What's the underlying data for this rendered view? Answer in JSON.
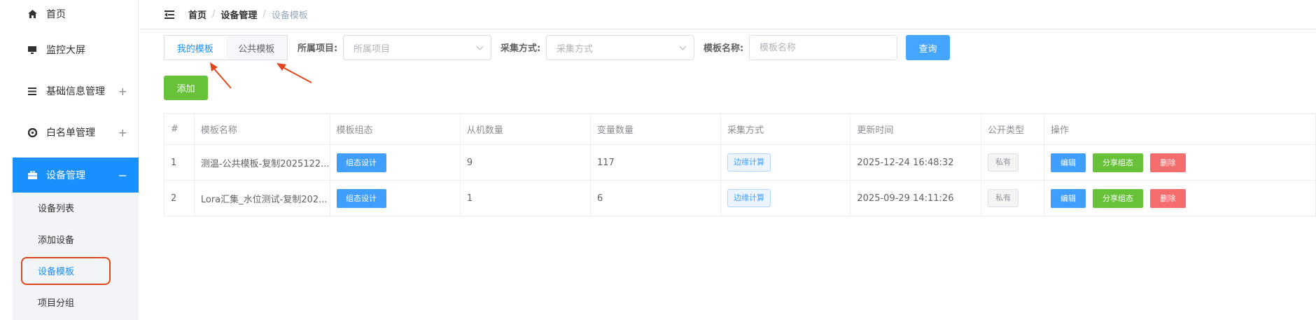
{
  "sidebar": {
    "items": [
      {
        "label": "首页",
        "icon": "home-icon"
      },
      {
        "label": "监控大屏",
        "icon": "monitor-icon"
      },
      {
        "label": "基础信息管理",
        "icon": "list-icon",
        "expand": "+"
      },
      {
        "label": "白名单管理",
        "icon": "whitelist-icon",
        "expand": "+"
      },
      {
        "label": "设备管理",
        "icon": "briefcase-icon",
        "expand": "−"
      }
    ],
    "submenu": [
      {
        "label": "设备列表"
      },
      {
        "label": "添加设备"
      },
      {
        "label": "设备模板"
      },
      {
        "label": "项目分组"
      }
    ]
  },
  "header": {
    "breadcrumb": [
      "首页",
      "设备管理",
      "设备模板"
    ],
    "separator": "/"
  },
  "tabs": [
    {
      "label": "我的模板",
      "active": true
    },
    {
      "label": "公共模板",
      "active": false
    }
  ],
  "filters": {
    "project_label": "所属项目:",
    "project_placeholder": "所属项目",
    "collect_label": "采集方式:",
    "collect_placeholder": "采集方式",
    "name_label": "模板名称:",
    "name_placeholder": "模板名称",
    "query_label": "查询"
  },
  "add_label": "添加",
  "table": {
    "headers": [
      "#",
      "模板名称",
      "模板组态",
      "从机数量",
      "变量数量",
      "采集方式",
      "更新时间",
      "公开类型",
      "操作"
    ],
    "rows": [
      {
        "index": "1",
        "name": "测温-公共模板-复制2025122...",
        "design": "组态设计",
        "slaves": "9",
        "vars": "117",
        "collect": "边缘计算",
        "updated": "2025-12-24 16:48:32",
        "public": "私有"
      },
      {
        "index": "2",
        "name": "Lora汇集_水位测试-复制202...",
        "design": "组态设计",
        "slaves": "1",
        "vars": "6",
        "collect": "边缘计算",
        "updated": "2025-09-29 14:11:26",
        "public": "私有"
      }
    ],
    "ops": {
      "edit": "编辑",
      "share": "分享组态",
      "delete": "删除"
    }
  },
  "colors": {
    "primary": "#1890ff",
    "success": "#67c23a",
    "danger": "#f56c6c",
    "annotation": "#e0461c"
  }
}
